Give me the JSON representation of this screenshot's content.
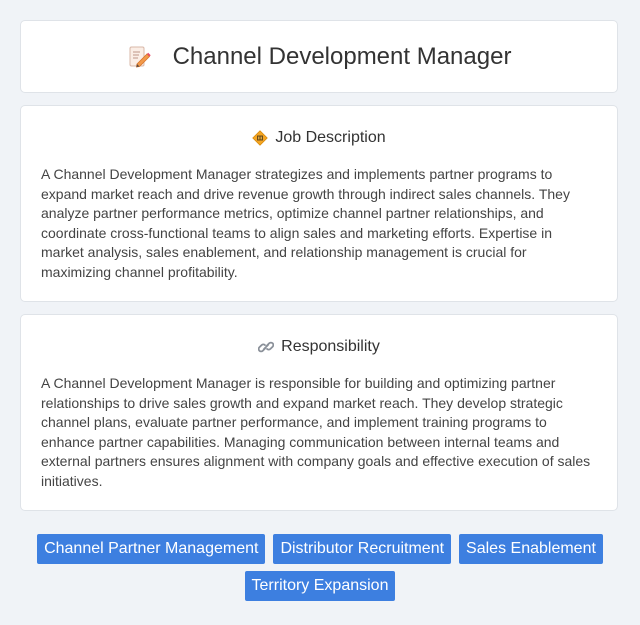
{
  "header": {
    "title": "Channel Development Manager",
    "icon": "memo-pencil-icon"
  },
  "sections": [
    {
      "title": "Job Description",
      "icon": "diamond-badge-icon",
      "text": "A Channel Development Manager strategizes and implements partner programs to expand market reach and drive revenue growth through indirect sales channels. They analyze partner performance metrics, optimize channel partner relationships, and coordinate cross-functional teams to align sales and marketing efforts. Expertise in market analysis, sales enablement, and relationship management is crucial for maximizing channel profitability."
    },
    {
      "title": "Responsibility",
      "icon": "link-icon",
      "text": "A Channel Development Manager is responsible for building and optimizing partner relationships to drive sales growth and expand market reach. They develop strategic channel plans, evaluate partner performance, and implement training programs to enhance partner capabilities. Managing communication between internal teams and external partners ensures alignment with company goals and effective execution of sales initiatives."
    }
  ],
  "tags": [
    "Channel Partner Management",
    "Distributor Recruitment",
    "Sales Enablement",
    "Territory Expansion"
  ],
  "colors": {
    "background": "#f0f3f7",
    "tag_background": "#3d7fe0",
    "tag_text": "#ffffff"
  }
}
